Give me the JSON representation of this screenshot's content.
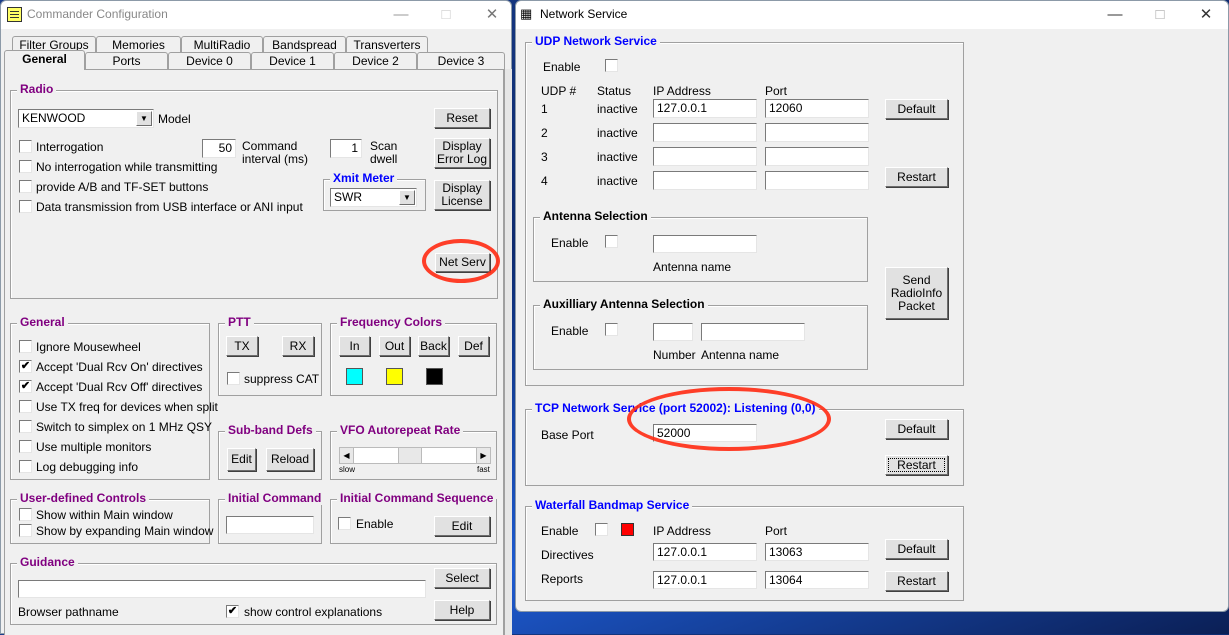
{
  "commander": {
    "title": "Commander Configuration",
    "tabs_row1": [
      "Filter Groups",
      "Memories",
      "MultiRadio",
      "Bandspread",
      "Transverters"
    ],
    "tabs_row2": [
      "General",
      "Ports",
      "Device 0",
      "Device 1",
      "Device 2",
      "Device 3"
    ],
    "active_tab": "General",
    "radio": {
      "title": "Radio",
      "model_value": "KENWOOD",
      "model_label": "Model",
      "reset": "Reset",
      "display_error_log": "Display Error Log",
      "display_license": "Display License",
      "interrogation": {
        "label": "Interrogation",
        "checked": false
      },
      "no_interrogation_tx": {
        "label": "No interrogation while transmitting",
        "checked": false
      },
      "ab_tfset": {
        "label": "provide A/B and TF-SET buttons",
        "checked": false
      },
      "usb_data": {
        "label": "Data transmission from USB interface or ANI input",
        "checked": false
      },
      "command_interval_value": "50",
      "command_interval_label": "Command interval (ms)",
      "scan_dwell_value": "1",
      "scan_dwell_label": "Scan dwell",
      "xmit_meter_title": "Xmit Meter",
      "xmit_meter_value": "SWR",
      "net_serv": "Net Serv"
    },
    "general": {
      "title": "General",
      "items": [
        {
          "label": "Ignore Mousewheel",
          "checked": false
        },
        {
          "label": "Accept 'Dual Rcv On' directives",
          "checked": true
        },
        {
          "label": "Accept 'Dual Rcv Off' directives",
          "checked": true
        },
        {
          "label": "Use TX freq for devices when split",
          "checked": false
        },
        {
          "label": "Switch to simplex on 1 MHz QSY",
          "checked": false
        },
        {
          "label": "Use multiple monitors",
          "checked": false
        },
        {
          "label": "Log debugging info",
          "checked": false
        }
      ]
    },
    "ptt": {
      "title": "PTT",
      "tx": "TX",
      "rx": "RX",
      "suppress_cat": {
        "label": "suppress CAT",
        "checked": false
      }
    },
    "freq_colors": {
      "title": "Frequency Colors",
      "buttons": [
        "In",
        "Out",
        "Back",
        "Def"
      ],
      "colors": [
        "#00ffff",
        "#ffff00",
        "#000000"
      ]
    },
    "subband": {
      "title": "Sub-band Defs",
      "edit": "Edit",
      "reload": "Reload"
    },
    "vfo_rate": {
      "title": "VFO Autorepeat Rate",
      "slow": "slow",
      "fast": "fast",
      "value_fraction": 0.45
    },
    "user_controls": {
      "title": "User-defined Controls",
      "show_within": {
        "label": "Show within Main window",
        "checked": false
      },
      "show_expanding": {
        "label": "Show by expanding Main window",
        "checked": false
      }
    },
    "initial_command": {
      "title": "Initial Command",
      "value": ""
    },
    "initial_sequence": {
      "title": "Initial Command Sequence",
      "enable": {
        "label": "Enable",
        "checked": false
      },
      "edit": "Edit"
    },
    "guidance": {
      "title": "Guidance",
      "path_value": "",
      "path_label": "Browser pathname",
      "select": "Select",
      "help": "Help",
      "show_explanations": {
        "label": "show control explanations",
        "checked": true
      }
    }
  },
  "network": {
    "title": "Network Service",
    "udp": {
      "title": "UDP Network Service",
      "enable_label": "Enable",
      "enable_checked": false,
      "headers": [
        "UDP #",
        "Status",
        "IP Address",
        "Port"
      ],
      "rows": [
        {
          "num": "1",
          "status": "inactive",
          "ip": "127.0.0.1",
          "port": "12060"
        },
        {
          "num": "2",
          "status": "inactive",
          "ip": "",
          "port": ""
        },
        {
          "num": "3",
          "status": "inactive",
          "ip": "",
          "port": ""
        },
        {
          "num": "4",
          "status": "inactive",
          "ip": "",
          "port": ""
        }
      ],
      "default": "Default",
      "restart": "Restart",
      "send_radioinfo": "Send RadioInfo Packet",
      "antenna": {
        "title": "Antenna Selection",
        "enable_label": "Enable",
        "checked": false,
        "name_value": "",
        "name_label": "Antenna name"
      },
      "aux_antenna": {
        "title": "Auxilliary Antenna Selection",
        "enable_label": "Enable",
        "checked": false,
        "number_value": "",
        "name_value": "",
        "number_label": "Number",
        "name_label": "Antenna name"
      }
    },
    "tcp": {
      "title": "TCP Network Service (port 52002): Listening (0,0)",
      "base_port_label": "Base Port",
      "base_port_value": "52000",
      "default": "Default",
      "restart": "Restart"
    },
    "waterfall": {
      "title": "Waterfall Bandmap Service",
      "enable_label": "Enable",
      "enable_checked": false,
      "status_color": "#ff0000",
      "ip_header": "IP Address",
      "port_header": "Port",
      "directives_label": "Directives",
      "directives_ip": "127.0.0.1",
      "directives_port": "13063",
      "reports_label": "Reports",
      "reports_ip": "127.0.0.1",
      "reports_port": "13064",
      "default": "Default",
      "restart": "Restart"
    }
  }
}
